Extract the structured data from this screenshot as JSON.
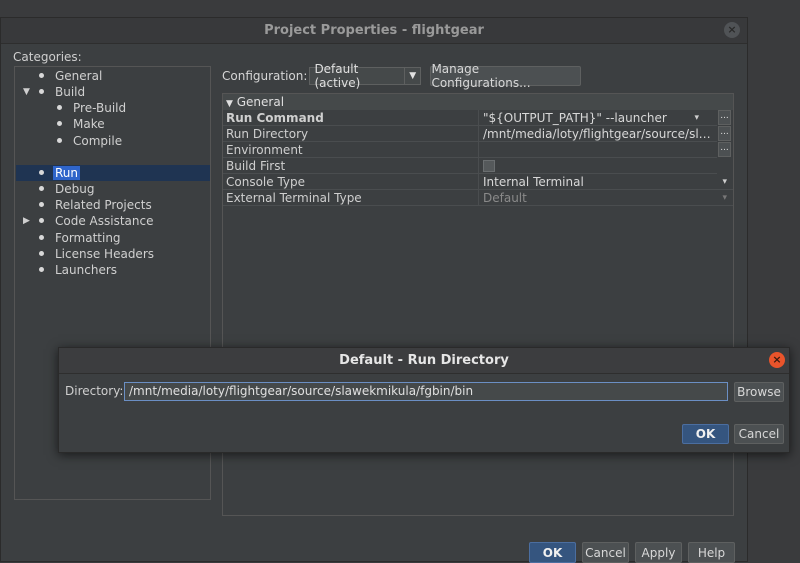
{
  "window": {
    "title": "Project Properties - flightgear",
    "close_glyph": "×"
  },
  "categories": {
    "label": "Categories:",
    "items": [
      {
        "label": "General"
      },
      {
        "label": "Build"
      },
      {
        "label": "Pre-Build"
      },
      {
        "label": "Make"
      },
      {
        "label": "Compile"
      },
      {
        "label": "Run"
      },
      {
        "label": "Debug"
      },
      {
        "label": "Related Projects"
      },
      {
        "label": "Code Assistance"
      },
      {
        "label": "Formatting"
      },
      {
        "label": "License Headers"
      },
      {
        "label": "Launchers"
      }
    ],
    "selected": "Run"
  },
  "configuration": {
    "label": "Configuration:",
    "value": "Default (active)",
    "manage_button": "Manage Configurations..."
  },
  "properties": {
    "section": "General",
    "rows": [
      {
        "name": "Run Command",
        "value": "\"${OUTPUT_PATH}\" --launcher"
      },
      {
        "name": "Run Directory",
        "value": "/mnt/media/loty/flightgear/source/slawek..."
      },
      {
        "name": "Environment",
        "value": ""
      },
      {
        "name": "Build First",
        "value": ""
      },
      {
        "name": "Console Type",
        "value": "Internal Terminal"
      },
      {
        "name": "External Terminal Type",
        "value": "Default"
      }
    ]
  },
  "buttons": {
    "ok": "OK",
    "cancel": "Cancel",
    "apply": "Apply",
    "help": "Help"
  },
  "dialog": {
    "title": "Default - Run Directory",
    "close_glyph": "×",
    "directory_label": "Directory:",
    "directory_value": "/mnt/media/loty/flightgear/source/slawekmikula/fgbin/bin",
    "browse": "Browse",
    "ok": "OK",
    "cancel": "Cancel"
  },
  "colors": {
    "accent": "#2f65ca",
    "dialog_close": "#e9542b",
    "primary_button": "#35557f"
  }
}
